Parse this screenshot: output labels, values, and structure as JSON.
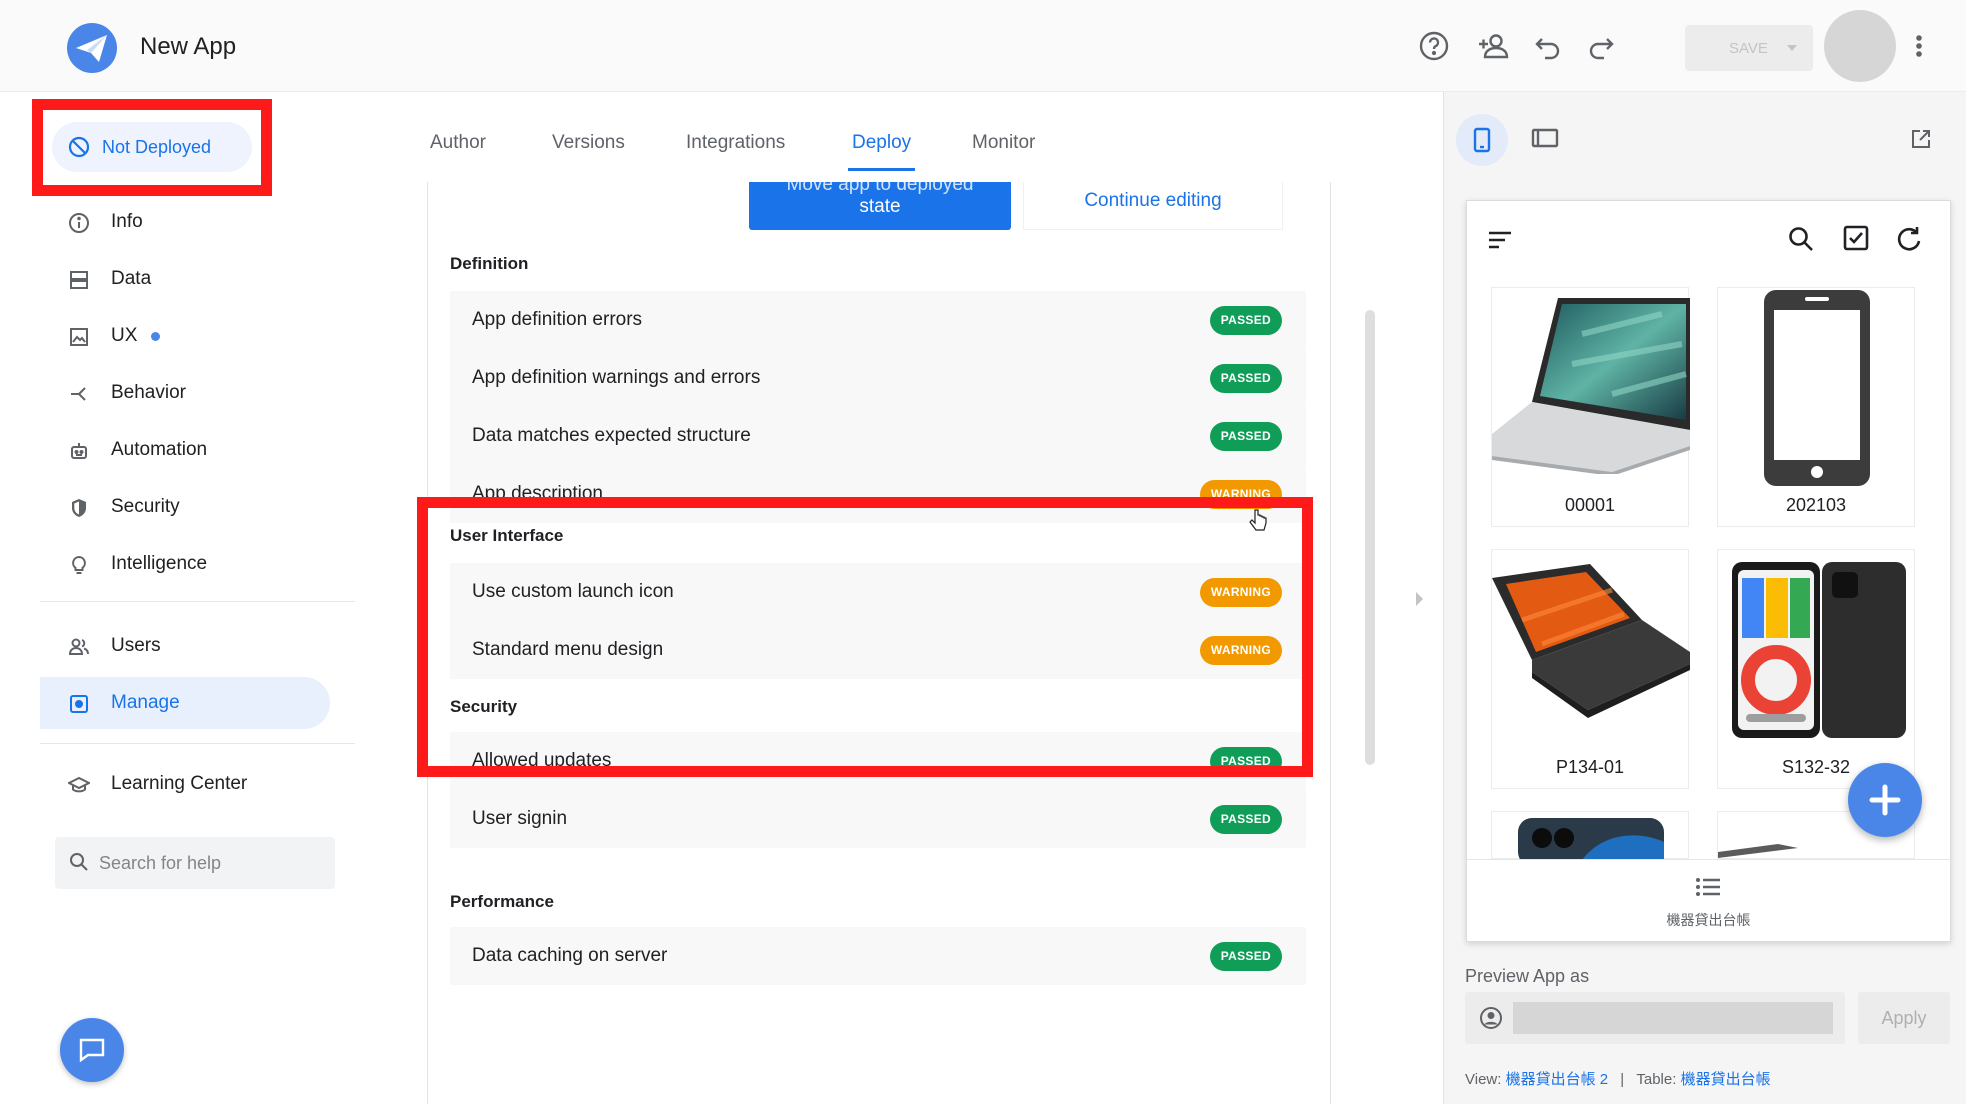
{
  "app": {
    "title": "New App"
  },
  "header": {
    "save_label": "SAVE"
  },
  "status": {
    "label": "Not Deployed"
  },
  "nav": {
    "items": [
      {
        "label": "Info",
        "icon": "info-icon"
      },
      {
        "label": "Data",
        "icon": "data-icon"
      },
      {
        "label": "UX",
        "icon": "ux-icon"
      },
      {
        "label": "Behavior",
        "icon": "behavior-icon"
      },
      {
        "label": "Automation",
        "icon": "automation-icon"
      },
      {
        "label": "Security",
        "icon": "security-icon"
      },
      {
        "label": "Intelligence",
        "icon": "intelligence-icon"
      },
      {
        "label": "Users",
        "icon": "users-icon"
      },
      {
        "label": "Manage",
        "icon": "manage-icon",
        "active": true
      },
      {
        "label": "Learning Center",
        "icon": "learning-center-icon"
      }
    ],
    "search_placeholder": "Search for help"
  },
  "tabs": [
    "Author",
    "Versions",
    "Integrations",
    "Deploy",
    "Monitor"
  ],
  "active_tab": "Deploy",
  "actions": {
    "move_label_partial": "Move app to deployed",
    "move_label_line2": "state",
    "continue_label": "Continue editing"
  },
  "sections": [
    {
      "title": "Definition",
      "checks": [
        {
          "label": "App definition errors",
          "status": "PASSED"
        },
        {
          "label": "App definition warnings and errors",
          "status": "PASSED"
        },
        {
          "label": "Data matches expected structure",
          "status": "PASSED"
        },
        {
          "label": "App description",
          "status": "WARNING"
        }
      ]
    },
    {
      "title": "User Interface",
      "checks": [
        {
          "label": "Use custom launch icon",
          "status": "WARNING"
        },
        {
          "label": "Standard menu design",
          "status": "WARNING"
        }
      ]
    },
    {
      "title": "Security",
      "checks": [
        {
          "label": "Allowed updates",
          "status": "PASSED"
        },
        {
          "label": "User signin",
          "status": "PASSED"
        }
      ]
    },
    {
      "title": "Performance",
      "checks": [
        {
          "label": "Data caching on server",
          "status": "PASSED"
        }
      ]
    }
  ],
  "colors": {
    "accent": "#1a73e8",
    "passed": "#0f9d58",
    "warning": "#f29900",
    "annotation": "#ff1a1a"
  },
  "preview": {
    "cards": [
      {
        "label": "00001",
        "image": "laptop-silver"
      },
      {
        "label": "202103",
        "image": "phone-outline-icon"
      },
      {
        "label": "P134-01",
        "image": "laptop-orange"
      },
      {
        "label": "S132-32",
        "image": "phones-pair"
      }
    ],
    "bottom_nav_label": "機器貸出台帳",
    "preview_as_label": "Preview App as",
    "apply_label": "Apply",
    "view_prefix": "View:",
    "view_name": "機器貸出台帳 2",
    "separator": "|",
    "table_prefix": "Table:",
    "table_name": "機器貸出台帳"
  }
}
